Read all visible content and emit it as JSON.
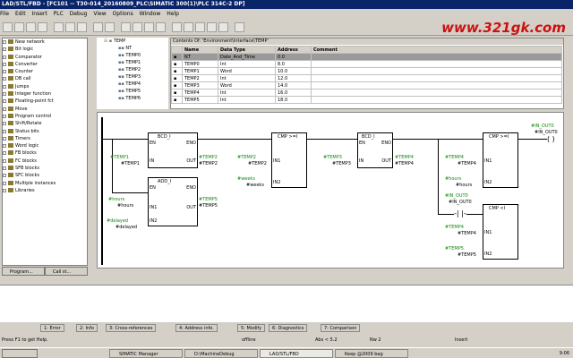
{
  "window": {
    "title": "LAD/STL/FBD - [FC101 -- T30-014_20160809_PLC\\SIMATIC 300(1)\\PLC 314C-2 DP]"
  },
  "menu": [
    "File",
    "Edit",
    "Insert",
    "PLC",
    "Debug",
    "View",
    "Options",
    "Window",
    "Help"
  ],
  "brand": "www.321gk.com",
  "tree": {
    "items": [
      "New network",
      "Bit logic",
      "Comparator",
      "Converter",
      "Counter",
      "DB call",
      "Jumps",
      "Integer function",
      "Floating-point fct",
      "Move",
      "Program control",
      "Shift/Rotate",
      "Status bits",
      "Timers",
      "Word logic",
      "FB blocks",
      "FC blocks",
      "SFB blocks",
      "SFC blocks",
      "Multiple instances",
      "Libraries"
    ],
    "tabs": [
      "Program...",
      "Call st..."
    ]
  },
  "interface": {
    "root": "TEMP",
    "items": [
      "NT",
      "TEMP0",
      "TEMP1",
      "TEMP2",
      "TEMP3",
      "TEMP4",
      "TEMP5",
      "TEMP6"
    ]
  },
  "contents": {
    "title": "Contents Of: 'Environment\\Interface\\TEMP'",
    "columns": [
      "Name",
      "Data Type",
      "Address",
      "Comment"
    ],
    "rows": [
      [
        "NT",
        "Date_And_Time",
        "0.0",
        ""
      ],
      [
        "TEMP0",
        "Int",
        "8.0",
        ""
      ],
      [
        "TEMP1",
        "Word",
        "10.0",
        ""
      ],
      [
        "TEMP2",
        "Int",
        "12.0",
        ""
      ],
      [
        "TEMP3",
        "Word",
        "14.0",
        ""
      ],
      [
        "TEMP4",
        "Int",
        "16.0",
        ""
      ],
      [
        "TEMP5",
        "Int",
        "18.0",
        ""
      ]
    ]
  },
  "ladder": {
    "bcd1": {
      "title": "BCD_I",
      "en": "EN",
      "eno": "ENO",
      "in": "IN",
      "out": "OUT",
      "in_sym": "#TEMP1",
      "in_var": "#TEMP1",
      "out_sym": "#TEMP2",
      "out_var": "#TEMP2"
    },
    "add1": {
      "title": "ADD_I",
      "en": "EN",
      "eno": "ENO",
      "in1": "IN1",
      "in2": "IN2",
      "out": "OUT",
      "in1_sym": "#hours",
      "in1_var": "#hours",
      "in2_sym": "#delayed",
      "in2_var": "#delayed",
      "out_sym": "#TEMP5",
      "out_var": "#TEMP5"
    },
    "cmp1": {
      "title": "CMP >=I",
      "in1": "IN1",
      "in2": "IN2",
      "in1_sym": "#TEMP2",
      "in1_var": "#TEMP2",
      "in2_sym": "#weeks",
      "in2_var": "#weeks"
    },
    "bcd2": {
      "title": "BCD_I",
      "en": "EN",
      "eno": "ENO",
      "in": "IN",
      "out": "OUT",
      "in_sym": "#TEMP3",
      "in_var": "#TEMP3",
      "out_sym": "#TEMP4",
      "out_var": "#TEMP4"
    },
    "cmp2": {
      "title": "CMP >=I",
      "in1": "IN1",
      "in2": "IN2",
      "in1_sym": "#TEMP4",
      "in1_var": "#TEMP4",
      "in2_sym": "#hours",
      "in2_var": "#hours"
    },
    "cmp3": {
      "title": "CMP <I",
      "in1": "IN1",
      "in2": "IN2",
      "in1_sym": "#TEMP4",
      "in1_var": "#TEMP4",
      "in2_sym": "#TEMP5",
      "in2_var": "#TEMP5"
    },
    "coil": {
      "sym": "#IN_OUT0",
      "var": "#IN_OUT0"
    },
    "contact": {
      "sym": "#IN_OUT0",
      "var": "#IN_OUT0"
    }
  },
  "output_tabs": [
    "1: Error",
    "2: Info",
    "3: Cross-references",
    "4: Address info.",
    "5: Modify",
    "6: Diagnostics",
    "7: Comparison"
  ],
  "status": {
    "left": "Press F1 to get Help.",
    "mode": "offline",
    "abs": "Abs < 5.2",
    "nw": "Nw 2",
    "insert": "Insert"
  },
  "taskbar": {
    "items": [
      "SIMATIC Manager",
      "D:\\MachineDebug",
      "LAD/STL/FBD",
      "Keep @2009 bag"
    ],
    "clock": "9:06"
  }
}
